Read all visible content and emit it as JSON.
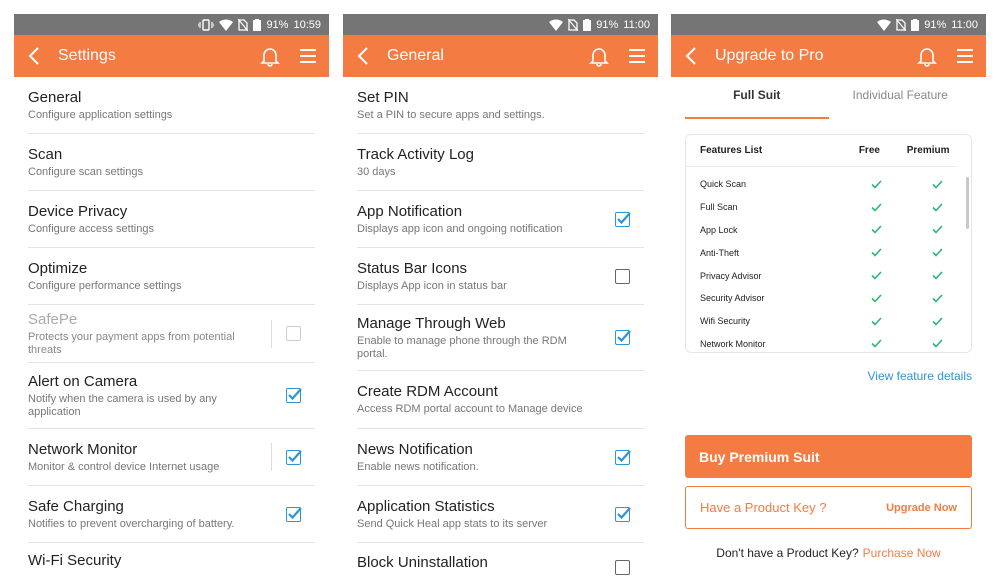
{
  "colors": {
    "accent": "#f47c43",
    "statusbar": "#757575",
    "checkbox": "#2d95d4",
    "link": "#2d95d4"
  },
  "screens": [
    {
      "status": {
        "battery": "91%",
        "time": "10:59"
      },
      "title": "Settings",
      "items": [
        {
          "title": "General",
          "subtitle": "Configure application settings"
        },
        {
          "title": "Scan",
          "subtitle": "Configure scan settings"
        },
        {
          "title": "Device Privacy",
          "subtitle": "Configure access settings"
        },
        {
          "title": "Optimize",
          "subtitle": "Configure performance settings"
        },
        {
          "title": "SafePe",
          "subtitle": "Protects your payment apps from potential threats",
          "checked": false,
          "disabled": true
        },
        {
          "title": "Alert on Camera",
          "subtitle": "Notify when the camera is used by any application",
          "checked": true
        },
        {
          "title": "Network Monitor",
          "subtitle": "Monitor & control device Internet usage",
          "checked": true
        },
        {
          "title": "Safe Charging",
          "subtitle": "Notifies to prevent overcharging of battery.",
          "checked": true
        },
        {
          "title": "Wi-Fi Security",
          "subtitle": ""
        }
      ]
    },
    {
      "status": {
        "battery": "91%",
        "time": "11:00"
      },
      "title": "General",
      "items": [
        {
          "title": "Set PIN",
          "subtitle": "Set a PIN to secure apps and settings."
        },
        {
          "title": "Track Activity Log",
          "subtitle": "30 days"
        },
        {
          "title": "App Notification",
          "subtitle": "Displays app icon and ongoing notification",
          "checked": true
        },
        {
          "title": "Status Bar Icons",
          "subtitle": "Displays App icon in status bar",
          "checked": false
        },
        {
          "title": "Manage Through Web",
          "subtitle": "Enable to manage phone through the RDM portal.",
          "checked": true
        },
        {
          "title": "Create RDM Account",
          "subtitle": "Access RDM portal account to Manage device"
        },
        {
          "title": "News Notification",
          "subtitle": "Enable news notification.",
          "checked": true
        },
        {
          "title": "Application Statistics",
          "subtitle": "Send Quick Heal app stats to its server",
          "checked": true
        },
        {
          "title": "Block Uninstallation",
          "subtitle": "",
          "checked": false
        }
      ]
    }
  ],
  "upgrade": {
    "status": {
      "battery": "91%",
      "time": "11:00"
    },
    "title": "Upgrade to Pro",
    "tabs": [
      "Full Suit",
      "Individual Feature"
    ],
    "table_headers": [
      "Features List",
      "Free",
      "Premium"
    ],
    "features": [
      "Quick Scan",
      "Full Scan",
      "App Lock",
      "Anti-Theft",
      "Privacy Advisor",
      "Security Advisor",
      "Wifi Security",
      "Network Monitor"
    ],
    "view_details": "View feature details",
    "buy_button": "Buy Premium Suit",
    "key_question": "Have a Product Key ?",
    "upgrade_now": "Upgrade Now",
    "no_key": "Don't have a Product Key?",
    "purchase_now": "Purchase Now"
  }
}
